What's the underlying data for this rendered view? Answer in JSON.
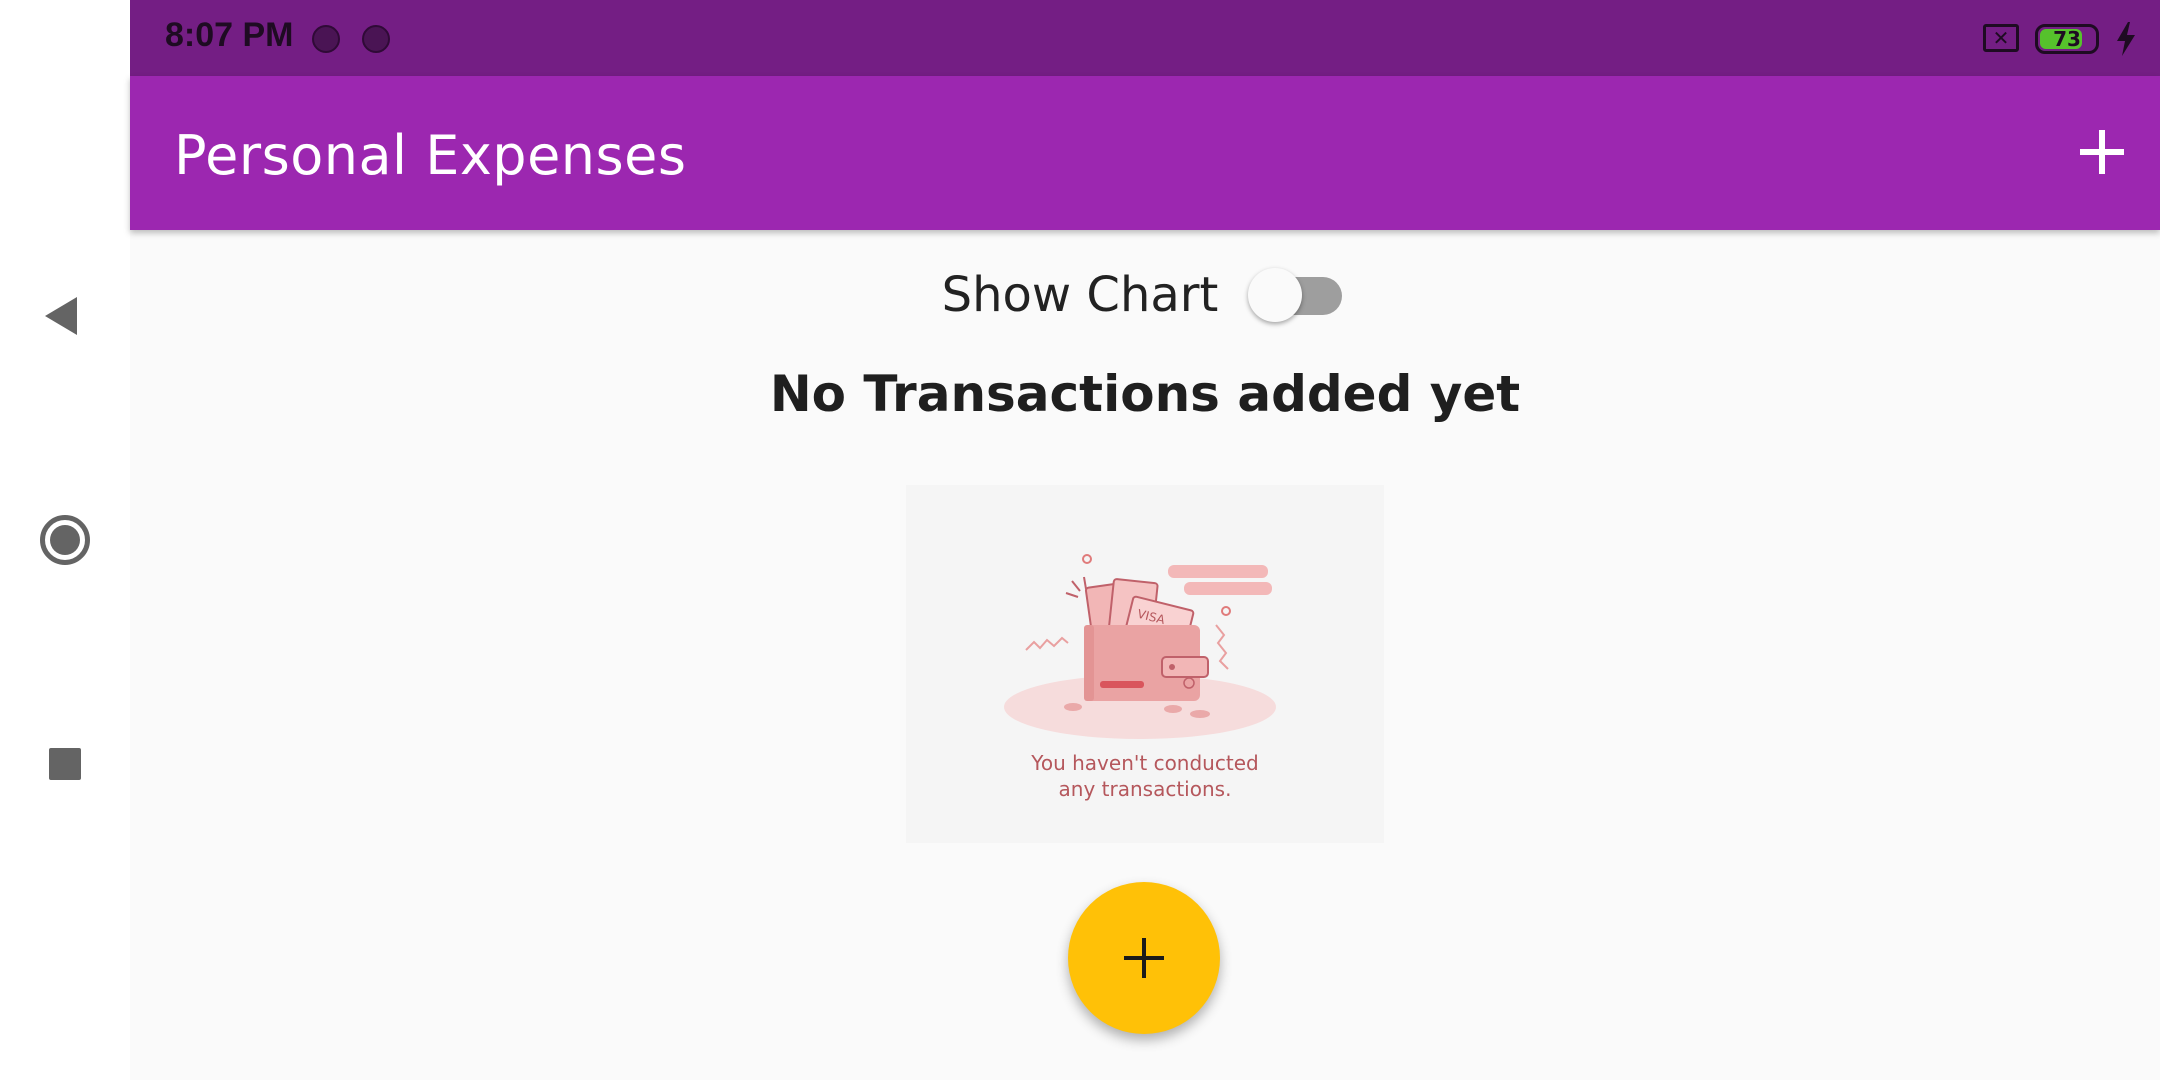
{
  "status_bar": {
    "time": "8:07 PM",
    "battery_level": "73"
  },
  "app_bar": {
    "title": "Personal Expenses",
    "add_icon": "plus-icon"
  },
  "chart_toggle": {
    "label": "Show Chart",
    "checked": false
  },
  "empty_state": {
    "title": "No Transactions added yet",
    "illustration_line1": "You haven't conducted",
    "illustration_line2": "any transactions.",
    "card_text": "VISA"
  },
  "fab": {
    "icon": "plus-icon"
  },
  "nav": {
    "back_icon": "back-triangle-icon",
    "home_icon": "home-circle-icon",
    "recents_icon": "recents-square-icon"
  },
  "colors": {
    "status_bar": "#741e84",
    "app_bar": "#9c27b0",
    "fab": "#ffc107",
    "illustration_accent": "#e57373"
  }
}
